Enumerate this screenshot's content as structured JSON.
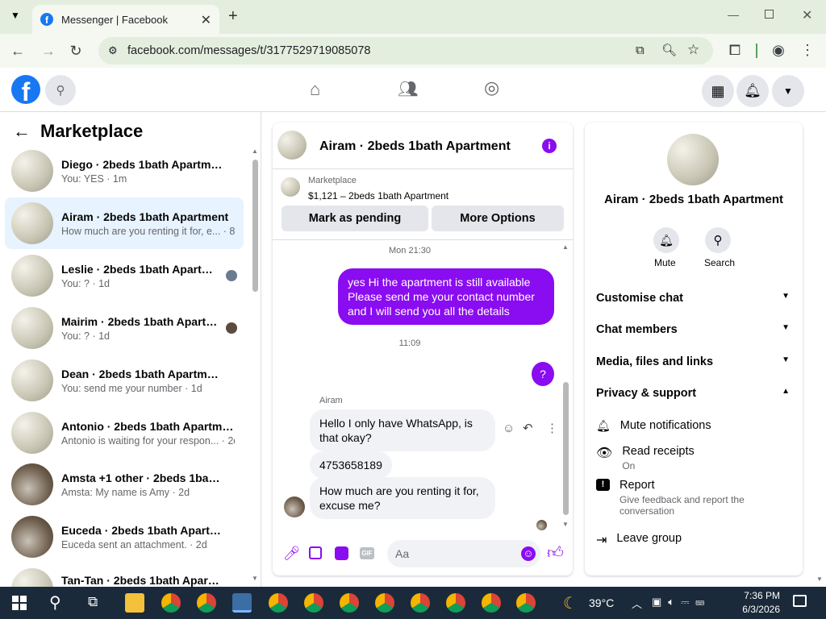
{
  "browser": {
    "tab_title": "Messenger | Facebook",
    "url": "facebook.com/messages/t/3177529719085078"
  },
  "left": {
    "title": "Marketplace",
    "conversations": [
      {
        "name": "Diego · 2beds 1bath Apartment",
        "preview": "You: YES · 1m"
      },
      {
        "name": "Airam · 2beds 1bath Apartment",
        "preview": "How much are you renting it for, e... · 8h"
      },
      {
        "name": "Leslie · 2beds 1bath Apartment",
        "preview": "You: ? · 1d"
      },
      {
        "name": "Mairim · 2beds 1bath Apartm...",
        "preview": "You: ? · 1d"
      },
      {
        "name": "Dean · 2beds 1bath Apartment",
        "preview": "You: send me your number · 1d"
      },
      {
        "name": "Antonio · 2beds 1bath Apartment",
        "preview": "Antonio is waiting for your respon... · 2d"
      },
      {
        "name": "Amsta +1 other · 2beds 1bath A...",
        "preview": "Amsta: My name is Amy · 2d"
      },
      {
        "name": "Euceda · 2beds 1bath Apartment",
        "preview": "Euceda sent an attachment. · 2d"
      },
      {
        "name": "Tan-Tan · 2beds 1bath Apartment",
        "preview": ""
      }
    ]
  },
  "chat": {
    "title": "Airam · 2beds 1bath Apartment",
    "listing_source": "Marketplace",
    "listing": "$1,121 – 2beds 1bath Apartment",
    "btn_pending": "Mark as pending",
    "btn_more": "More Options",
    "ts1": "Mon 21:30",
    "msg_me_1": "yes Hi the apartment is still available Please send me your contact number and I will send you all the details",
    "ts2": "11:09",
    "msg_me_2": "?",
    "sender": "Airam",
    "msg_them_1": "Hello I only have WhatsApp, is that okay?",
    "msg_them_2": "4753658189",
    "msg_them_3": "How much are you renting it for, excuse me?",
    "input_placeholder": "Aa"
  },
  "details": {
    "name": "Airam · 2beds 1bath Apartment",
    "mute": "Mute",
    "search": "Search",
    "sections": [
      "Customise chat",
      "Chat members",
      "Media, files and links",
      "Privacy & support"
    ],
    "mute_notifications": "Mute notifications",
    "read_receipts": "Read receipts",
    "read_receipts_state": "On",
    "report": "Report",
    "report_desc": "Give feedback and report the conversation",
    "leave": "Leave group"
  },
  "taskbar": {
    "weather": "39°C",
    "time": "7:36 PM",
    "date": "6/3/2026"
  },
  "colors": {
    "accent": "#8a0cf0",
    "fb_blue": "#1877f2"
  }
}
